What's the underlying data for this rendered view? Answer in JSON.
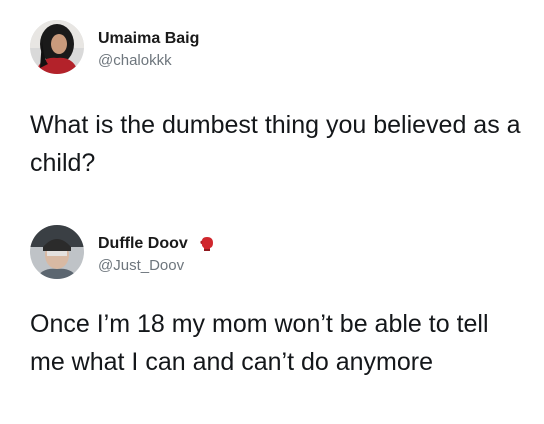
{
  "tweets": [
    {
      "display_name": "Umaima Baig",
      "handle": "@chalokkk",
      "text": "What is the dumbest thing you believed as a child?",
      "avatar_icon": "profile-photo"
    },
    {
      "display_name": "Duffle Doov",
      "handle": "@Just_Doov",
      "text": "Once I’m 18 my mom won’t be able to tell me what I can and can’t do anymore",
      "avatar_icon": "profile-photo",
      "badge_icon": "boxing-glove-icon",
      "badge_color": "#d0262d"
    }
  ]
}
